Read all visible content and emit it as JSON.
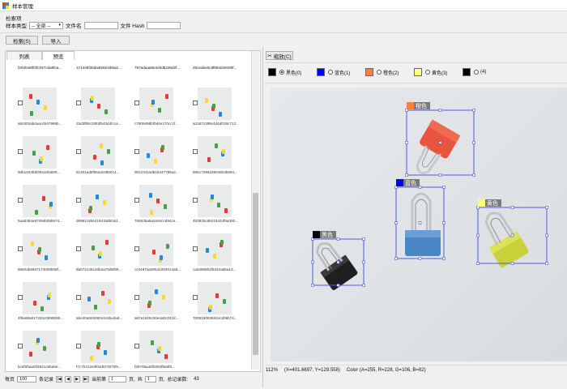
{
  "window": {
    "title": "样本管理"
  },
  "filter": {
    "group_label": "检索项",
    "type_label": "样本类型",
    "type_value": "-- 全部 --",
    "file_name_label": "文件名",
    "file_hash_label": "文件 Hash",
    "file_name_value": "",
    "file_hash_value": ""
  },
  "toolbar": {
    "search_label": "检索(S)",
    "import_label": "导入"
  },
  "tabs": {
    "list_label": "列表",
    "preview_label": "预览"
  },
  "thumbnails": {
    "top_row_captions": [
      "f20d04d0f3fc047cda5fca...",
      "171446f35da4845c6b5a2...",
      "797adaaa6e4d4d5226d2f...",
      "25ceabe0c8f954d49460f..."
    ],
    "items": [
      {
        "caption": "a5c803ab4aac4b47999b...",
        "checked": false
      },
      {
        "caption": "25d3f95c2853f543d4fcca...",
        "checked": false
      },
      {
        "caption": "c7809458bf0d4e170cc1f...",
        "checked": false
      },
      {
        "caption": "a2187c289c4d4d018c713...",
        "checked": false
      },
      {
        "caption": "9db1934b5f39410fa936...",
        "checked": false
      },
      {
        "caption": "51301ad8f55a4c09b014...",
        "checked": false
      },
      {
        "caption": "00210cb4d815447789a2...",
        "checked": false
      },
      {
        "caption": "59517299d3904604b054...",
        "checked": false
      },
      {
        "caption": "5aa5384e87394b05b574...",
        "checked": false
      },
      {
        "caption": "d0951c8544194156b04d...",
        "checked": false
      },
      {
        "caption": "708335a5a2a94ccd94ce...",
        "checked": false
      },
      {
        "caption": "4b0825c65315444f9a300...",
        "checked": false
      },
      {
        "caption": "6682ab5657174006b08f...",
        "checked": false
      },
      {
        "caption": "6bb7214610db4a70d5f99...",
        "checked": false
      },
      {
        "caption": "cc0497aa30544293914a8...",
        "checked": false
      },
      {
        "caption": "ca0485601f5342a5ba13...",
        "checked": false
      },
      {
        "caption": "4f9a68a817334c0599b06...",
        "checked": false
      },
      {
        "caption": "a5e40a84609044c6ba3a6...",
        "checked": false
      },
      {
        "caption": "a67a1926c00e4a0c031fc...",
        "checked": false
      },
      {
        "caption": "7005180936844cd06b74...",
        "checked": false
      },
      {
        "caption": "bc5f0faa26f3841c6ba6e...",
        "checked": false
      },
      {
        "caption": "f7c7b412e8f04d673970fe...",
        "checked": false
      },
      {
        "caption": "f29706a45f0394f9a6f8...",
        "checked": false
      }
    ]
  },
  "pager": {
    "per_page_label": "每页",
    "per_page_value": "100",
    "records_label": "条记录",
    "current_page_label": "当前第",
    "current_page_value": "1",
    "page_unit": "页,",
    "total_label": "共",
    "total_pages_value": "1",
    "page_unit2": "页,",
    "total_records_label": "总记录数:",
    "total_records_value": "43"
  },
  "annotator": {
    "label_button": "缩放(C)",
    "legend": [
      {
        "color": "#000000",
        "label": "黑色(0)",
        "selected": true
      },
      {
        "color": "#0000ff",
        "label": "蓝色(1)",
        "selected": false
      },
      {
        "color": "#ff7f3f",
        "label": "橙色(2)",
        "selected": false
      },
      {
        "color": "#ffff80",
        "label": "黄色(3)",
        "selected": false
      },
      {
        "color": "#000000",
        "label": "(4)",
        "selected": false
      }
    ],
    "boxes": [
      {
        "label": "橙色",
        "color": "#ff7f3f"
      },
      {
        "label": "蓝色",
        "color": "#0000ff"
      },
      {
        "label": "黄色",
        "color": "#ffff80"
      },
      {
        "label": "黑色",
        "color": "#000000"
      }
    ]
  },
  "status": {
    "zoom": "112%",
    "coords": "(X=401.6697, Y=129.558)",
    "color": "Color (A=255, R=228, G=106, B=82)"
  },
  "colors": {
    "box_outline": "#4b5bdc",
    "canvas_bg": "#e3e6e9"
  }
}
